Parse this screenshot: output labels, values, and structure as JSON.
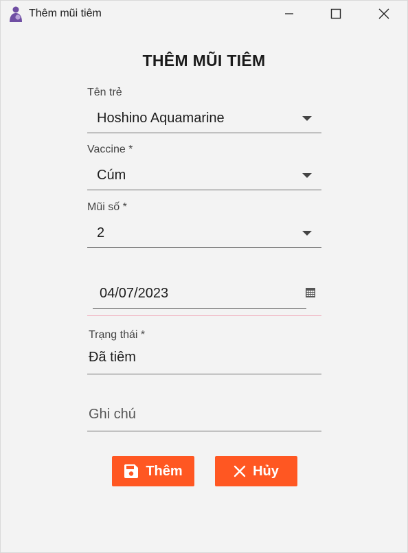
{
  "window": {
    "title": "Thêm mũi tiêm"
  },
  "form": {
    "heading": "THÊM MŨI TIÊM",
    "child": {
      "label": "Tên trẻ",
      "value": "Hoshino Aquamarine"
    },
    "vaccine": {
      "label": "Vaccine *",
      "value": "Cúm"
    },
    "dose": {
      "label": "Mũi số *",
      "value": "2"
    },
    "date": {
      "value": "04/07/2023"
    },
    "status": {
      "label": "Trạng thái *",
      "value": "Đã tiêm"
    },
    "note": {
      "placeholder": "Ghi chú",
      "value": ""
    }
  },
  "buttons": {
    "add_label": "Thêm",
    "cancel_label": "Hủy"
  },
  "colors": {
    "accent": "#ff5722",
    "app_icon": "#6f4ea3"
  }
}
